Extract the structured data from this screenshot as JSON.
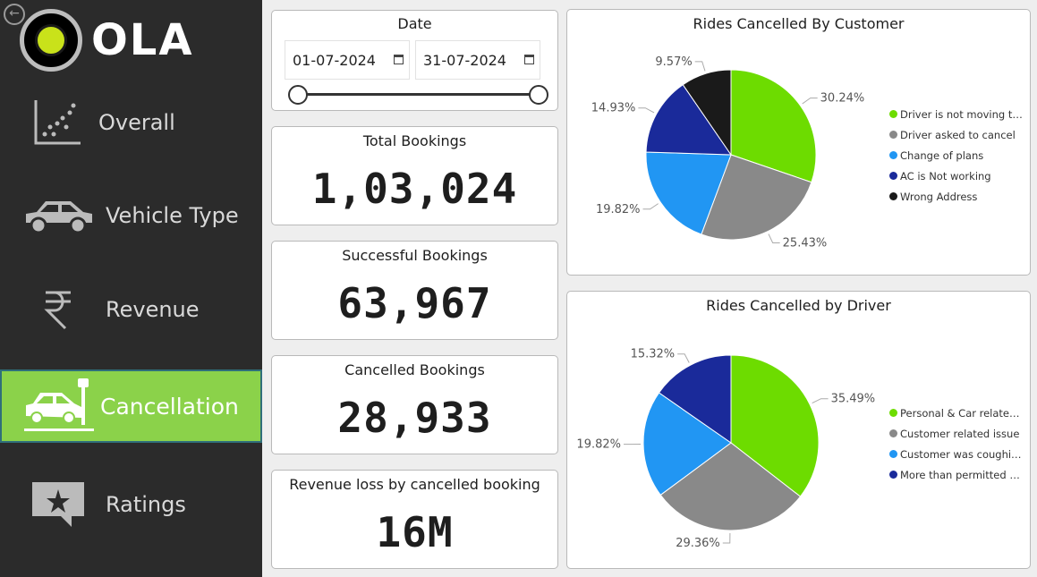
{
  "brand": {
    "name": "OLA"
  },
  "nav": [
    {
      "label": "Overall",
      "icon": "scatter-plot-icon",
      "active": false
    },
    {
      "label": "Vehicle Type",
      "icon": "car-icon",
      "active": false
    },
    {
      "label": "Revenue",
      "icon": "rupee-icon",
      "active": false
    },
    {
      "label": "Cancellation",
      "icon": "car-crash-icon",
      "active": true
    },
    {
      "label": "Ratings",
      "icon": "star-comment-icon",
      "active": false
    }
  ],
  "date_filter": {
    "title": "Date",
    "start": "01-07-2024",
    "end": "31-07-2024"
  },
  "kpis": [
    {
      "title": "Total Bookings",
      "value": "1,03,024"
    },
    {
      "title": "Successful Bookings",
      "value": "63,967"
    },
    {
      "title": "Cancelled Bookings",
      "value": "28,933"
    },
    {
      "title": "Revenue loss by cancelled booking",
      "value": "16M"
    }
  ],
  "colors": {
    "green": "#6ddc00",
    "gray": "#898989",
    "lightblue": "#2196f3",
    "darkblue": "#1a2a9a",
    "black": "#1a1a1a",
    "active_nav": "#8bd24a"
  },
  "chart_data": [
    {
      "type": "pie",
      "title": "Rides Cancelled By Customer",
      "categories": [
        "Driver is not moving to...",
        "Driver asked to cancel",
        "Change of plans",
        "AC is Not working",
        "Wrong Address"
      ],
      "values": [
        30.24,
        25.43,
        19.82,
        14.93,
        9.57
      ],
      "labels": [
        "30.24%",
        "25.43%",
        "19.82%",
        "14.93%",
        "9.57%"
      ],
      "colors": [
        "#6ddc00",
        "#898989",
        "#2196f3",
        "#1a2a9a",
        "#1a1a1a"
      ],
      "legend": "right"
    },
    {
      "type": "pie",
      "title": "Rides Cancelled by Driver",
      "categories": [
        "Personal & Car related...",
        "Customer related issue",
        "Customer was coughin...",
        "More than permitted p..."
      ],
      "values": [
        35.49,
        29.36,
        19.82,
        15.32
      ],
      "labels": [
        "35.49%",
        "29.36%",
        "19.82%",
        "15.32%"
      ],
      "colors": [
        "#6ddc00",
        "#898989",
        "#2196f3",
        "#1a2a9a"
      ],
      "legend": "right"
    }
  ]
}
